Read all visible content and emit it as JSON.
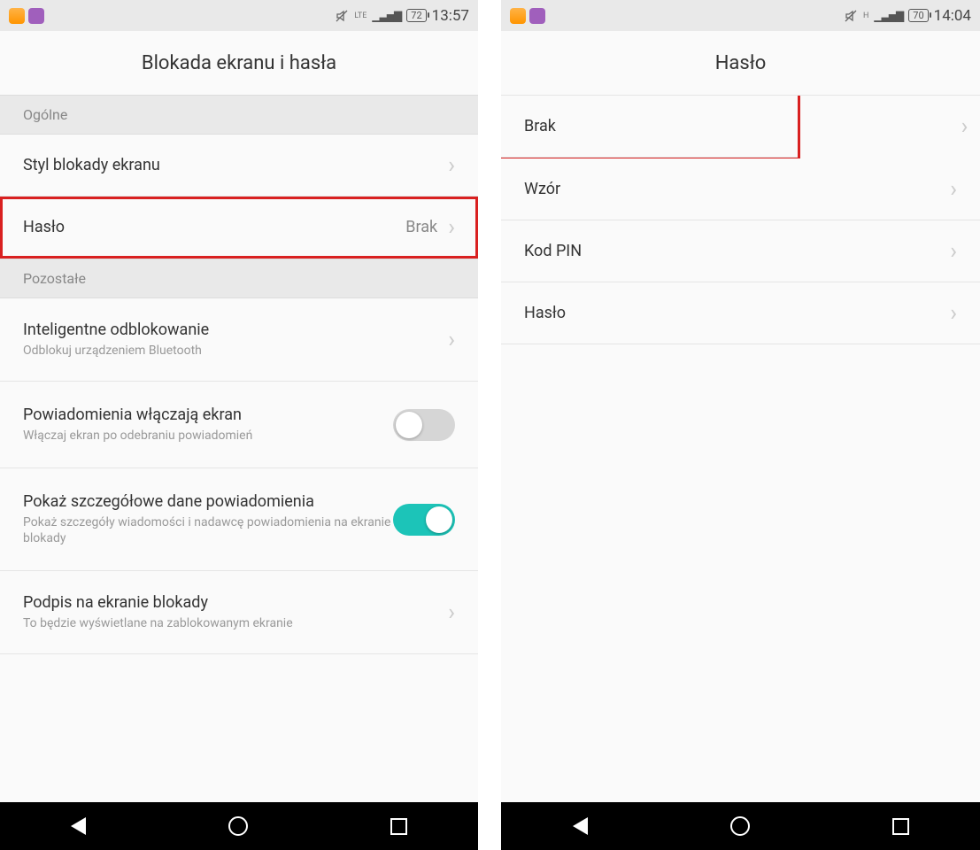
{
  "left": {
    "status": {
      "network": "LTE",
      "battery": "72",
      "time": "13:57"
    },
    "title": "Blokada ekranu i hasła",
    "section1": "Ogólne",
    "row_style": "Styl blokady ekranu",
    "row_password": {
      "label": "Hasło",
      "value": "Brak"
    },
    "section2": "Pozostałe",
    "row_smart": {
      "label": "Inteligentne odblokowanie",
      "sub": "Odblokuj urządzeniem Bluetooth"
    },
    "row_notif": {
      "label": "Powiadomienia włączają ekran",
      "sub": "Włączaj ekran po odebraniu powiadomień"
    },
    "row_detail": {
      "label": "Pokaż szczegółowe dane powiadomienia",
      "sub": "Pokaż szczegóły wiadomości i nadawcę powiadomienia na ekranie blokady"
    },
    "row_sig": {
      "label": "Podpis na ekranie blokady",
      "sub": "To będzie wyświetlane na zablokowanym ekranie"
    }
  },
  "right": {
    "status": {
      "network": "H",
      "battery": "70",
      "time": "14:04"
    },
    "title": "Hasło",
    "options": [
      "Brak",
      "Wzór",
      "Kod PIN",
      "Hasło"
    ]
  }
}
